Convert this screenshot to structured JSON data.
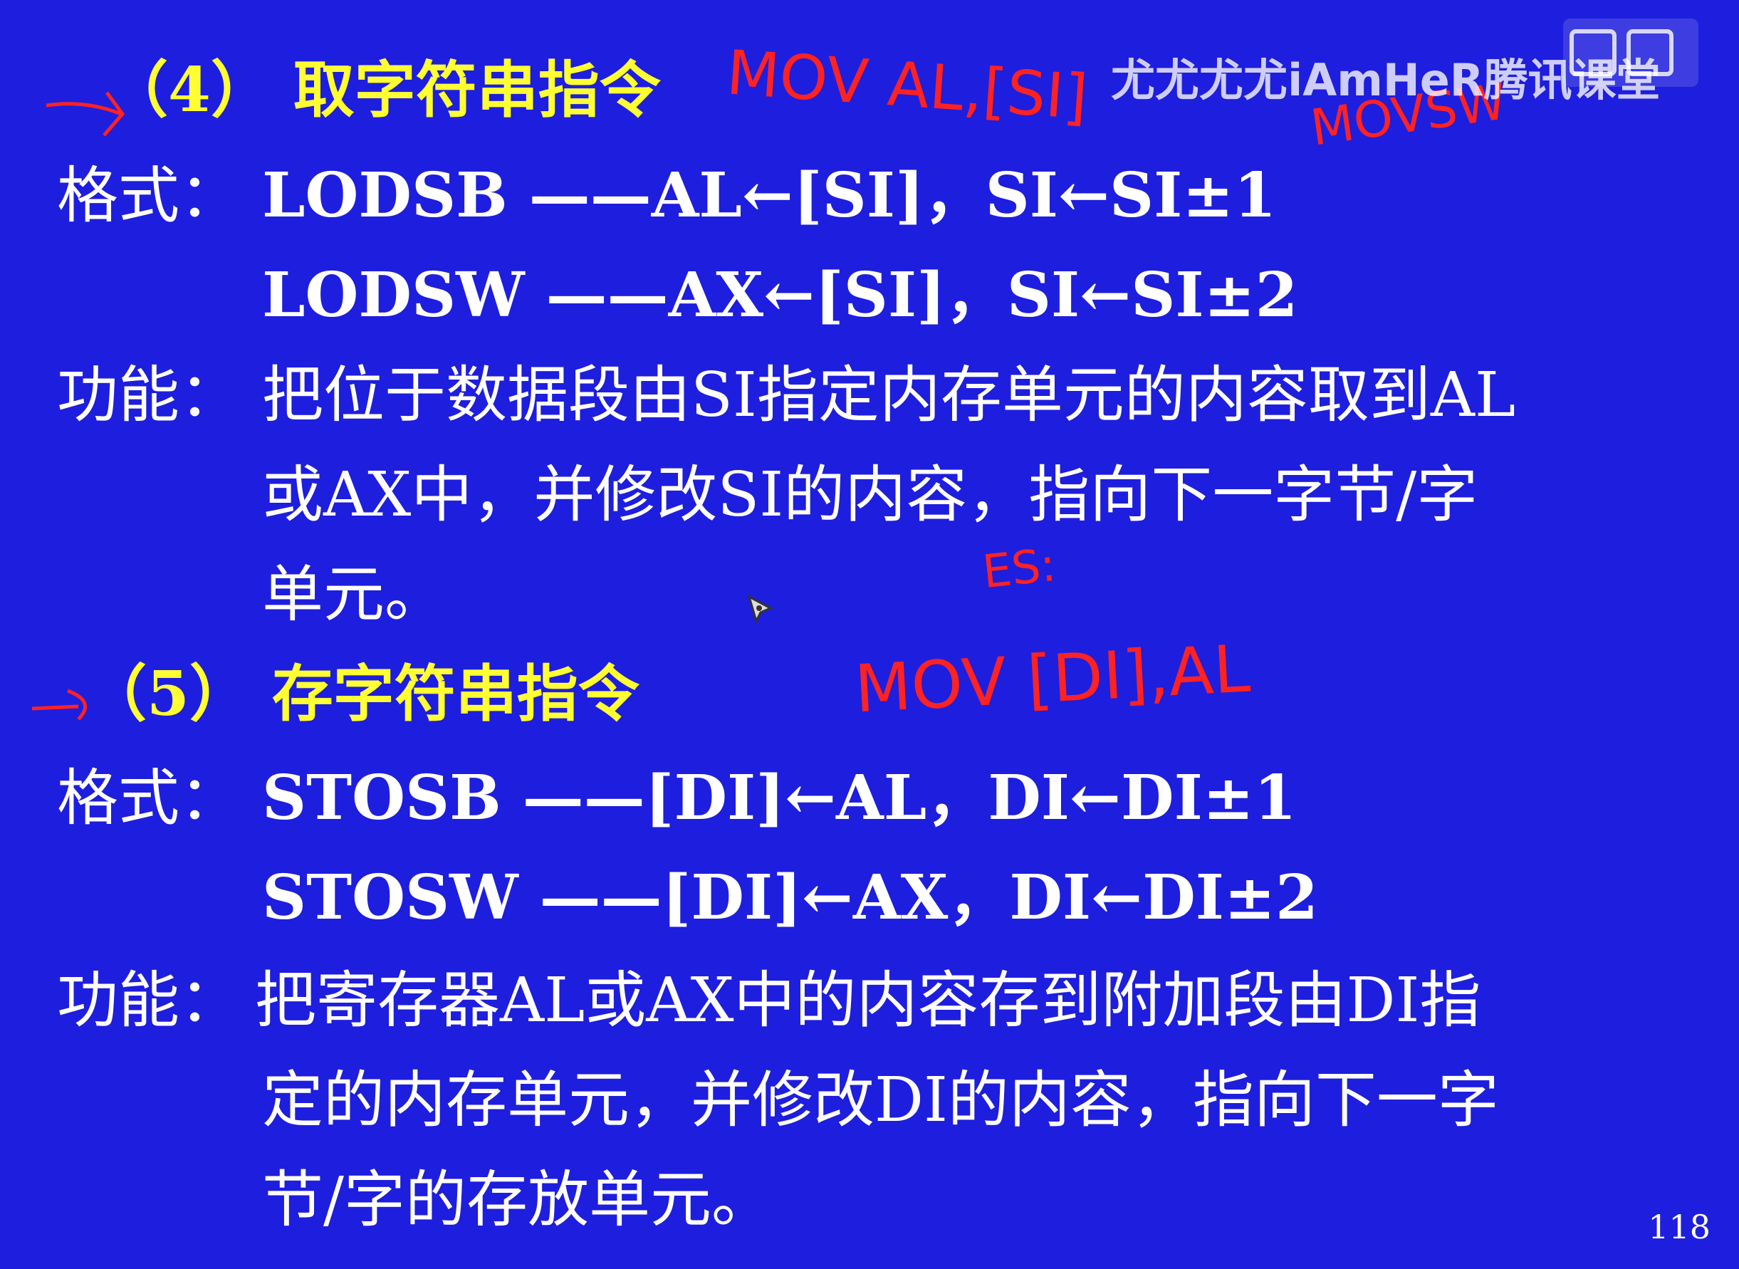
{
  "slide": {
    "watermark": "尤尤尤尤iAmHeR腾讯课堂",
    "page_number": "118",
    "section4": {
      "heading": "（4） 取字符串指令",
      "format_label": "格式：",
      "format_line1": "LODSB  ——AL←[SI]，SI←SI±1",
      "format_line2": "LODSW  ——AX←[SI]，SI←SI±2",
      "function_label": "功能：",
      "function_line1": "把位于数据段由SI指定内存单元的内容取到AL",
      "function_line2": "或AX中，并修改SI的内容，指向下一字节/字",
      "function_line3": "单元。"
    },
    "section5": {
      "heading": "（5） 存字符串指令",
      "format_label": "格式：",
      "format_line1": "STOSB ——[DI]←AL，DI←DI±1",
      "format_line2": "STOSW ——[DI]←AX，DI←DI±2",
      "function_label": "功能：",
      "function_line1": "把寄存器AL或AX中的内容存到附加段由DI指",
      "function_line2": "定的内存单元，并修改DI的内容，指向下一字",
      "function_line3": "节/字的存放单元。"
    },
    "annotations": {
      "note1": "MOV AL,[SI]",
      "note2": "MOVSW",
      "note3": "MOV [DI],AL",
      "note4": "ES:"
    }
  },
  "colors": {
    "background": "#1e1ede",
    "heading": "#ffff33",
    "text": "#ffffff",
    "annotation": "#ff2222"
  }
}
